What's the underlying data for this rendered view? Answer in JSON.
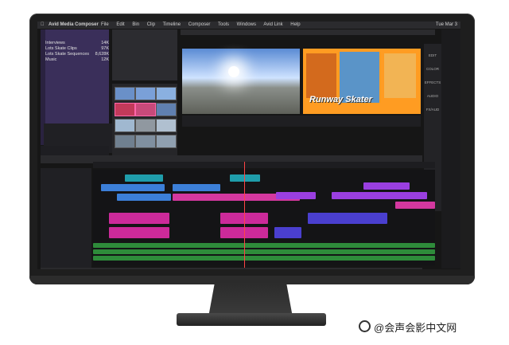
{
  "menubar": {
    "app_name": "Avid Media Composer",
    "items": [
      "File",
      "Edit",
      "Bin",
      "Clip",
      "Timeline",
      "Composer",
      "Tools",
      "Windows",
      "Avid Link",
      "Help"
    ],
    "clock": "Tue Mar 3"
  },
  "bin": {
    "title": "Interviews",
    "rows": [
      {
        "name": "Interviews",
        "count": "14K"
      },
      {
        "name": "Lots Skate Clips",
        "count": "97K"
      },
      {
        "name": "Lots Skate Sequences",
        "count": "8,628K"
      },
      {
        "name": "Music",
        "count": "12K"
      }
    ]
  },
  "viewer": {
    "title_overlay_1": "Runway",
    "title_overlay_2": "Skater"
  },
  "tools": {
    "items": [
      "EDIT",
      "COLOR",
      "EFFECTS",
      "AUDIO",
      "FX/AUD"
    ]
  },
  "watermark": "@会声会影中文网",
  "colors": {
    "video_clip": "#3c7fd8",
    "teal_clip": "#1f9dab",
    "purple_clip": "#9a3fe0",
    "magenta_audio": "#cc2a9a",
    "green_track": "#2e8b3a",
    "bin_bg": "#3a2f5a"
  }
}
